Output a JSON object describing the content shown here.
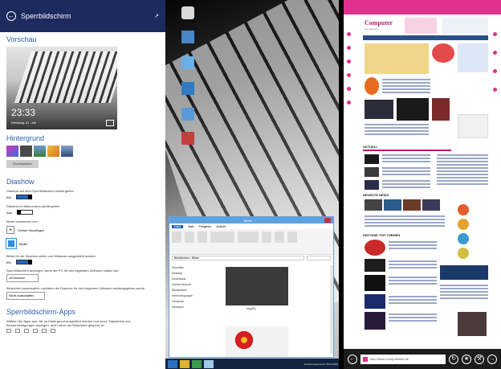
{
  "settings": {
    "header_title": "Sperrbildschirm",
    "preview_title": "Vorschau",
    "preview_time": "23:33",
    "preview_date": "Dienstag, 31. Juli",
    "background_title": "Hintergrund",
    "browse_label": "Durchsuchen",
    "slideshow_title": "Diashow",
    "slideshow_toggle_text": "Diashow auf dem Sperrbildschirm wiedergeben",
    "slideshow_toggle_value": "Ein",
    "battery_toggle_text": "Diashow im Akkumodus wiedergeben",
    "battery_toggle_value": "Aus",
    "pictures_text": "Bilder verwenden von:",
    "add_folder_label": "Ordner hinzufügen",
    "pictures_folder_label": "Bilder",
    "fit_text": "Bilder für die Diashow sollen von Windows ausgewählt werden",
    "fit_value": "Ein",
    "inactive_text": "Sperrbildschirm anzeigen, wenn der PC für den folgenden Zeitraum inaktiv war",
    "inactive_select": "15 Minuten",
    "screen_off_text": "Bildschirm ausschalten, nachdem die Diashow für den folgenden Zeitraum wiedergegeben wurde",
    "screen_off_select": "Nicht ausschalten",
    "apps_title": "Sperrbildschirm-Apps",
    "apps_text": "Wählen Sie Apps aus, die im Hintergrund ausgeführt werden und kurze Statusinfos und Benachrichtigungen anzeigen, auch wenn der Bildschirm gesperrt ist"
  },
  "explorer": {
    "title": "Bilder",
    "tabs": [
      "Datei",
      "Start",
      "Freigeben",
      "Ansicht"
    ],
    "address": "Bibliotheken › Bilder",
    "nav_items": [
      "Favoriten",
      "Desktop",
      "Downloads",
      "Zuletzt besucht",
      "",
      "Bibliotheken",
      "",
      "Heimnetzgruppe",
      "",
      "Computer",
      "",
      "Netzwerk"
    ],
    "photo_caption": "Img001"
  },
  "taskbar": {
    "tray_text": "Evaluierungsversion Build 8400"
  },
  "browser": {
    "logo": "Computer",
    "logo_sub": "Das Magazin",
    "news_heading_1": "AKTUELL",
    "news_heading_2": "NEUESTE NEWS",
    "news_heading_3": "HISTORIE TOP-THEMEN",
    "url": "http://www.computerbild.de"
  },
  "colors": {
    "settings_header": "#1c2a5e",
    "accent_blue": "#2a5faa",
    "browser_pink": "#e0318c",
    "taskbar": "#12233f",
    "app_bar": "#1c1c1c"
  },
  "icons": [
    "back-arrow-icon",
    "pin-icon",
    "plus-icon",
    "folder-icon",
    "close-icon",
    "refresh-icon",
    "favorite-icon",
    "wrench-icon"
  ]
}
